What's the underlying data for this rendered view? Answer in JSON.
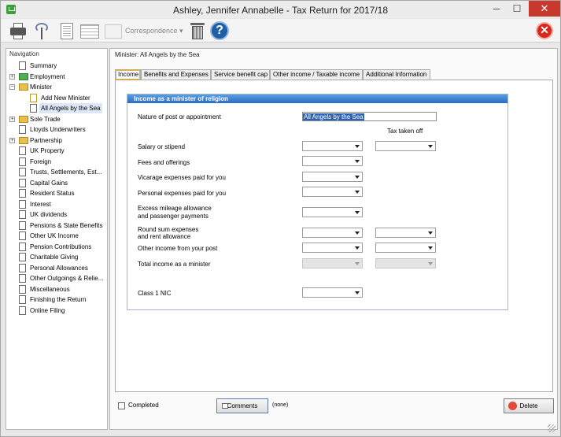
{
  "window": {
    "title": "Ashley, Jennifer Annabelle - Tax Return for 2017/18",
    "min": "─",
    "max": "☐",
    "close": "✕"
  },
  "toolbar": {
    "correspondence": "Correspondence ▾",
    "help": "?",
    "exit": "✕"
  },
  "nav": {
    "title": "Navigation",
    "items": [
      {
        "label": "Summary"
      },
      {
        "label": "Employment"
      },
      {
        "label": "Minister"
      },
      {
        "label": "Add New Minister"
      },
      {
        "label": "All Angels by the Sea"
      },
      {
        "label": "Sole Trade"
      },
      {
        "label": "Lloyds Underwriters"
      },
      {
        "label": "Partnership"
      },
      {
        "label": "UK Property"
      },
      {
        "label": "Foreign"
      },
      {
        "label": "Trusts, Settlements, Est..."
      },
      {
        "label": "Capital Gains"
      },
      {
        "label": "Resident Status"
      },
      {
        "label": "Interest"
      },
      {
        "label": "UK dividends"
      },
      {
        "label": "Pensions & State Benefits"
      },
      {
        "label": "Other UK Income"
      },
      {
        "label": "Pension Contributions"
      },
      {
        "label": "Charitable Giving"
      },
      {
        "label": "Personal Allowances"
      },
      {
        "label": "Other Outgoings & Relie..."
      },
      {
        "label": "Miscellaneous"
      },
      {
        "label": "Finishing the Return"
      },
      {
        "label": "Online Filing"
      }
    ],
    "expanders": {
      "plus": "+",
      "minus": "−"
    }
  },
  "main": {
    "breadcrumb": "Minister: All Angels by the Sea",
    "tabs": [
      "Income",
      "Benefits and Expenses",
      "Service benefit cap",
      "Other income / Taxable income",
      "Additional Information"
    ],
    "panel_title": "Income as a minister of religion",
    "nature_label": "Nature of post or appointment",
    "nature_value": "All Angels by the Sea",
    "tax_taken_off": "Tax taken off",
    "fields": [
      "Salary or stipend",
      "Fees and offerings",
      "Vicarage expenses paid for you",
      "Personal expenses paid for you",
      "Excess mileage allowance",
      "and passenger payments",
      "Round sum expenses",
      "and rent allowance",
      "Other income from your post",
      "Total income as a minister",
      "Class 1 NIC"
    ]
  },
  "bottom": {
    "completed": "Completed",
    "comments": "Comments",
    "comments_status": "(none)",
    "delete": "Delete"
  }
}
